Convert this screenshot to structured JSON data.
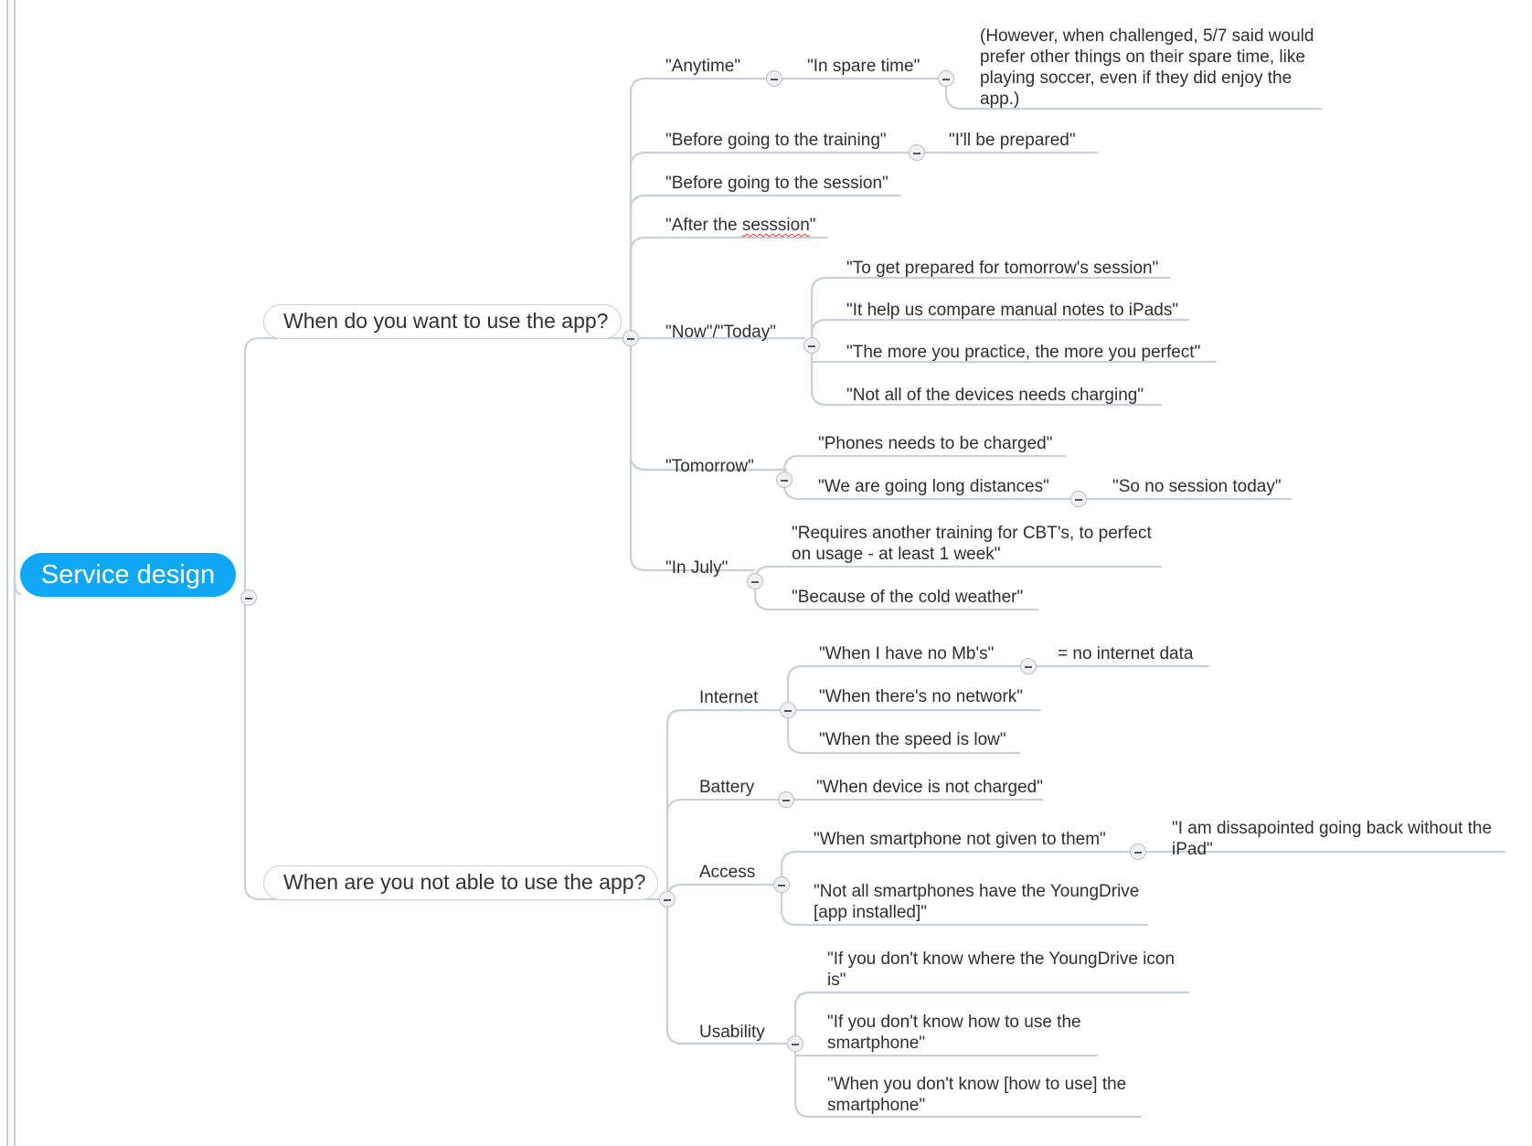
{
  "root": {
    "label": "Service design"
  },
  "q1": {
    "label": "When do you want to use the app?",
    "anytime": "\"Anytime\"",
    "spare_time": "\"In spare time\"",
    "however": "(However, when challenged, 5/7 said would prefer other things on their spare time, like playing soccer, even if they did enjoy the app.)",
    "before_training": "\"Before going to the training\"",
    "prepared": "\"I'll be prepared\"",
    "before_session": "\"Before going to the session\"",
    "after_prefix": "\"After the ",
    "after_word": "sesssion",
    "after_suffix": "\"",
    "now_today": "\"Now\"/\"Today\"",
    "now_children": [
      "\"To get prepared for tomorrow's session\"",
      "\"It help us compare manual notes to iPads\"",
      "\"The more you practice, the more you perfect\"",
      "\"Not all of the devices needs charging\""
    ],
    "tomorrow": "\"Tomorrow\"",
    "phones_charged": "\"Phones needs to be charged\"",
    "long_distances": "\"We are going long distances\"",
    "no_session": "\"So no session today\"",
    "in_july": "\"In July\"",
    "requires_training": "\"Requires another training for CBT's, to perfect on usage - at least 1 week\"",
    "cold_weather": "\"Because of the cold weather\""
  },
  "q2": {
    "label": "When are you not able to use the app?",
    "internet": "Internet",
    "no_mbs": "\"When I have no Mb's\"",
    "no_internet_data": "= no internet data",
    "no_network": "\"When there's no network\"",
    "speed_low": "\"When the speed is low\"",
    "battery": "Battery",
    "not_charged": "\"When device is not charged\"",
    "access": "Access",
    "not_given": "\"When smartphone not given to them\"",
    "disappointed": "\"I am dissapointed going back without the iPad\"",
    "not_all_phones": "\"Not all smartphones have the YoungDrive [app installed]\"",
    "usability": "Usability",
    "icon_unknown": "\"If you don't know where the YoungDrive icon is\"",
    "how_to_use": "\"If you don't know how to use the smartphone\"",
    "dont_know": "\"When you don't know [how to use] the smartphone\""
  },
  "colors": {
    "root": "#0fa8f5",
    "line": "#c9d1d6",
    "spellcheck": "#e53935"
  }
}
